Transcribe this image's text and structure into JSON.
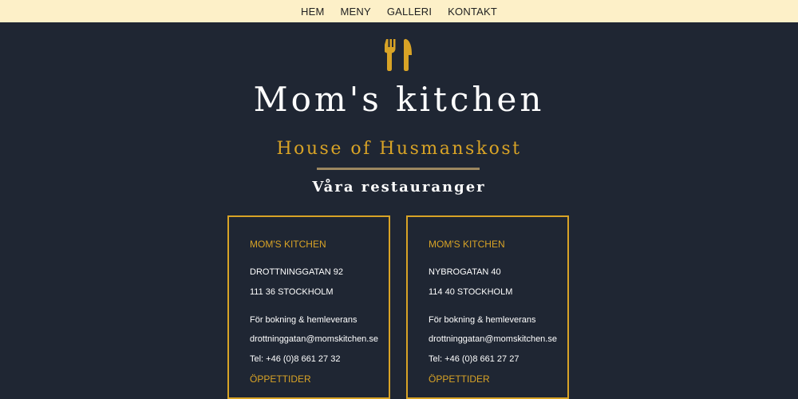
{
  "nav": {
    "items": [
      "HEM",
      "MENY",
      "GALLERI",
      "KONTAKT"
    ]
  },
  "logo": {
    "icon": "fork-knife-icon",
    "color": "#d8a326"
  },
  "hero": {
    "title": "Mom's kitchen",
    "subtitle": "House of Husmanskost",
    "section_title": "Våra restauranger"
  },
  "colors": {
    "background": "#1f2633",
    "accent": "#d8a326",
    "nav_bg": "#fdf0c8"
  },
  "restaurants": [
    {
      "name": "MOM'S KITCHEN",
      "street": "DROTTNINGGATAN 92",
      "city": "111 36 STOCKHOLM",
      "booking": "För bokning & hemleverans",
      "email": "drottninggatan@momskitchen.se",
      "phone": "Tel: +46 (0)8 661 27 32",
      "hours_label": "ÖPPETTIDER"
    },
    {
      "name": "MOM'S KITCHEN",
      "street": "NYBROGATAN 40",
      "city": "114 40 STOCKHOLM",
      "booking": "För bokning & hemleverans",
      "email": "drottninggatan@momskitchen.se",
      "phone": "Tel: +46 (0)8 661 27 27",
      "hours_label": "ÖPPETTIDER"
    }
  ]
}
